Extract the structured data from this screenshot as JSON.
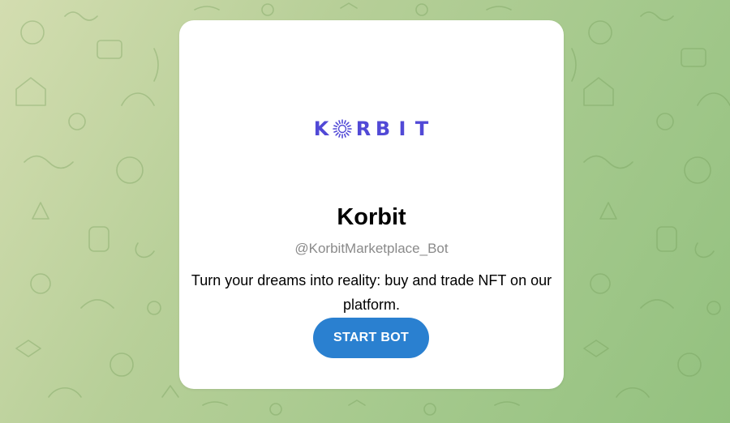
{
  "background": {
    "pattern": "telegram-doodle-pattern",
    "colors": [
      "#d3ddb0",
      "#a5c98d",
      "#93c17f"
    ]
  },
  "card": {
    "logo": {
      "letters": [
        "K",
        "R",
        "B",
        "I",
        "T"
      ],
      "icon": "korbit-o-ring-icon",
      "color": "#5149d6"
    },
    "title": "Korbit",
    "username": "@KorbitMarketplace_Bot",
    "description": "Turn your dreams into reality: buy and trade NFT on our platform.",
    "start_button": "START BOT",
    "button_color": "#2a80d0"
  }
}
